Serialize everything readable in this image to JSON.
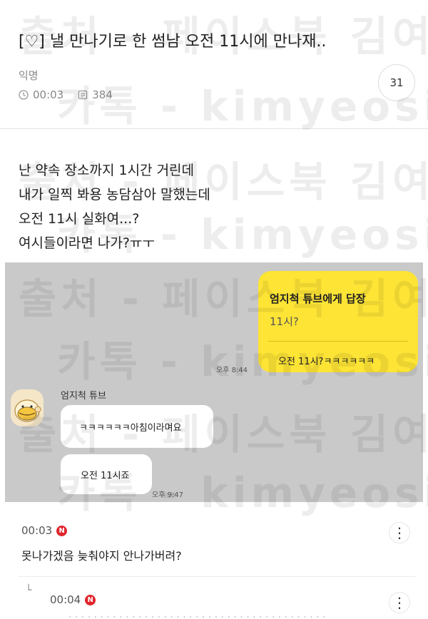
{
  "post": {
    "title": "[♡] 낼 만나기로 한 썸남 오전 11시에 만나재..",
    "author": "익명",
    "time": "00:03",
    "views": "384",
    "comment_count": "31"
  },
  "body": {
    "lines": [
      "난 약속 장소까지 1시간 거린데",
      "내가 일찍 봐용 농담삼아 말했는데",
      "오전 11시 실화여...?",
      "여시들이라면 나가?ㅠㅜ"
    ]
  },
  "chat": {
    "reply_title": "엄지척 튜브에게 답장",
    "reply_quote": "11시?",
    "reply_message": "오전 11시?ㅋㅋㅋㅋㅋㅋ",
    "reply_time": "오후 8:44",
    "sender": "엄지척 튜브",
    "messages": [
      "ㅋㅋㅋㅋㅋㅋ아침이라며요",
      "오전 11시죠"
    ],
    "last_time": "오후 9:47"
  },
  "comments": [
    {
      "time": "00:03",
      "badge": "N",
      "text": "못나가겠음 늦춰야지 안나가버려?"
    },
    {
      "time": "00:04",
      "badge": "N"
    }
  ],
  "watermarks": [
    "출처 - 페이스북 김여시",
    "카톡 - kimyeosi"
  ],
  "colors": {
    "chat_bg": "#c9c9c9",
    "kakao_yellow": "#fde435",
    "badge_red": "#e0252c"
  }
}
